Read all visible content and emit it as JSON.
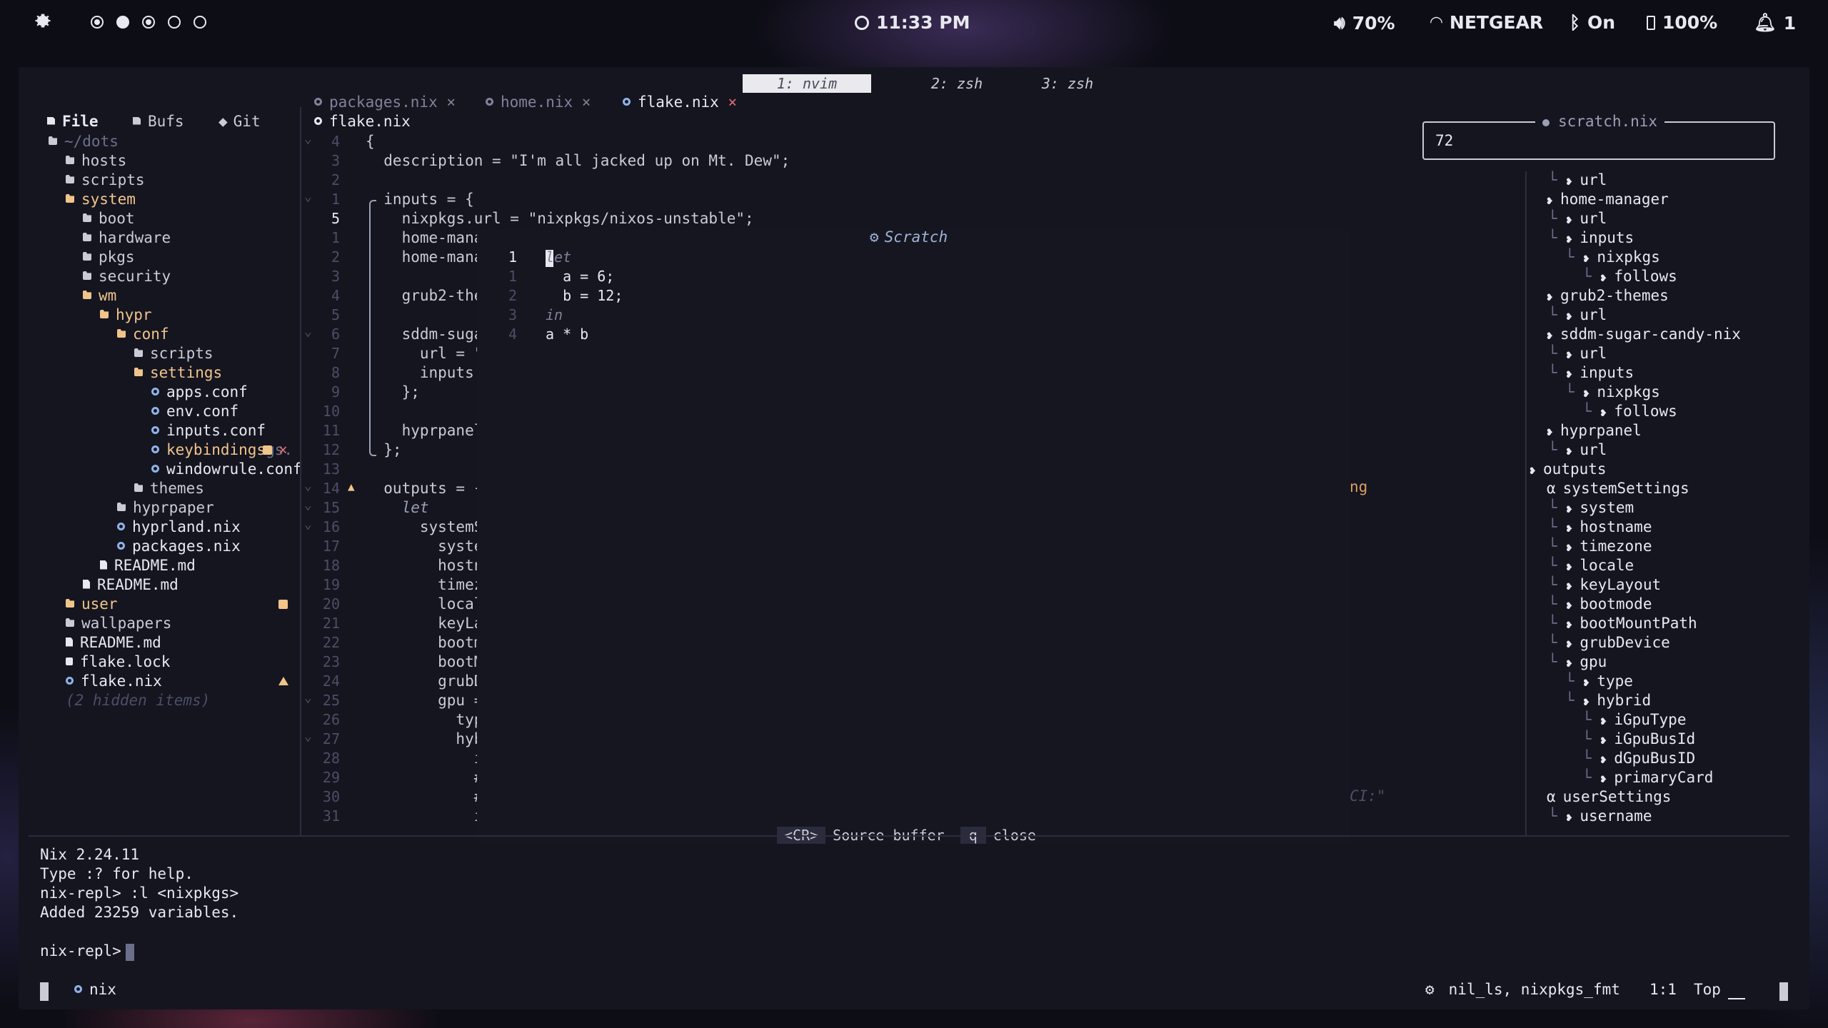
{
  "topbar": {
    "clock": "11:33 PM",
    "volume": "70%",
    "network": "NETGEAR",
    "bluetooth": "On",
    "battery": "100%",
    "notifications": "1"
  },
  "tmux_tabs": [
    "1: nvim",
    "2: zsh",
    "3: zsh"
  ],
  "explorer": {
    "tabs": [
      "File",
      "Bufs",
      "Git"
    ],
    "items": [
      {
        "label": "~/dots",
        "indent": 0,
        "icon": "folder-open-icon",
        "color": "#6b6f8a"
      },
      {
        "label": "hosts",
        "indent": 1,
        "icon": "folder-icon",
        "color": "#c9cbd6"
      },
      {
        "label": "scripts",
        "indent": 1,
        "icon": "folder-icon",
        "color": "#c9cbd6"
      },
      {
        "label": "system",
        "indent": 1,
        "icon": "folder-open-icon",
        "color": "#f0c58a"
      },
      {
        "label": "boot",
        "indent": 2,
        "icon": "folder-icon",
        "color": "#c9cbd6"
      },
      {
        "label": "hardware",
        "indent": 2,
        "icon": "folder-icon",
        "color": "#c9cbd6"
      },
      {
        "label": "pkgs",
        "indent": 2,
        "icon": "folder-icon",
        "color": "#c9cbd6"
      },
      {
        "label": "security",
        "indent": 2,
        "icon": "folder-icon",
        "color": "#c9cbd6"
      },
      {
        "label": "wm",
        "indent": 2,
        "icon": "folder-open-icon",
        "color": "#f0c58a"
      },
      {
        "label": "hypr",
        "indent": 3,
        "icon": "folder-open-icon",
        "color": "#f0c58a"
      },
      {
        "label": "conf",
        "indent": 4,
        "icon": "folder-open-icon",
        "color": "#f0c58a"
      },
      {
        "label": "scripts",
        "indent": 5,
        "icon": "folder-icon",
        "color": "#c9cbd6"
      },
      {
        "label": "settings",
        "indent": 5,
        "icon": "folder-open-icon",
        "color": "#f0c58a"
      },
      {
        "label": "apps.conf",
        "indent": 6,
        "icon": "gear-icon",
        "color": "#e8e8ef"
      },
      {
        "label": "env.conf",
        "indent": 6,
        "icon": "gear-icon",
        "color": "#e8e8ef"
      },
      {
        "label": "inputs.conf",
        "indent": 6,
        "icon": "gear-icon",
        "color": "#e8e8ef"
      },
      {
        "label": "keybindings",
        "indent": 6,
        "icon": "gear-icon",
        "color": "#f0c58a",
        "trail": "gs.",
        "badge": "modified",
        "close": "×"
      },
      {
        "label": "windowrule.conf",
        "indent": 6,
        "icon": "gear-icon",
        "color": "#e8e8ef"
      },
      {
        "label": "themes",
        "indent": 5,
        "icon": "folder-icon",
        "color": "#c9cbd6"
      },
      {
        "label": "hyprpaper",
        "indent": 4,
        "icon": "folder-icon",
        "color": "#c9cbd6"
      },
      {
        "label": "hyprland.nix",
        "indent": 4,
        "icon": "gear-icon",
        "color": "#e8e8ef"
      },
      {
        "label": "packages.nix",
        "indent": 4,
        "icon": "gear-icon",
        "color": "#e8e8ef"
      },
      {
        "label": "README.md",
        "indent": 3,
        "icon": "doc-icon",
        "color": "#e8e8ef"
      },
      {
        "label": "README.md",
        "indent": 2,
        "icon": "doc-icon",
        "color": "#e8e8ef"
      },
      {
        "label": "user",
        "indent": 1,
        "icon": "folder-icon",
        "color": "#f0c58a",
        "badge": "modified"
      },
      {
        "label": "wallpapers",
        "indent": 1,
        "icon": "folder-icon",
        "color": "#c9cbd6"
      },
      {
        "label": "README.md",
        "indent": 1,
        "icon": "doc-icon",
        "color": "#e8e8ef"
      },
      {
        "label": "flake.lock",
        "indent": 1,
        "icon": "lock-icon",
        "color": "#e8e8ef"
      },
      {
        "label": "flake.nix",
        "indent": 1,
        "icon": "gear-icon",
        "color": "#e8e8ef",
        "badge": "warning"
      },
      {
        "label": "(2 hidden items)",
        "indent": 1,
        "icon": "",
        "color": "#4b4e66",
        "italic": true
      }
    ]
  },
  "buffer_tabs": [
    {
      "label": "packages.nix",
      "close": "×",
      "active": false
    },
    {
      "label": "home.nix",
      "close": "×",
      "active": false
    },
    {
      "label": "flake.nix",
      "close": "×",
      "active": true
    }
  ],
  "breadcrumb": "flake.nix",
  "editor": {
    "lines": [
      {
        "n": "4",
        "fold": "⌄",
        "text": "{"
      },
      {
        "n": "3",
        "fold": "",
        "text": "  description = \"I'm all jacked up on Mt. Dew\";"
      },
      {
        "n": "2",
        "fold": "",
        "text": ""
      },
      {
        "n": "1",
        "fold": "⌄",
        "text": "  inputs = {"
      },
      {
        "n": "5",
        "fold": "",
        "text": "    nixpkgs.url = \"nixpkgs/nixos-unstable\";",
        "current": true
      },
      {
        "n": "1",
        "fold": "",
        "text": "    home-mana"
      },
      {
        "n": "2",
        "fold": "",
        "text": "    home-mana"
      },
      {
        "n": "3",
        "fold": "",
        "text": ""
      },
      {
        "n": "4",
        "fold": "",
        "text": "    grub2-the"
      },
      {
        "n": "5",
        "fold": "",
        "text": ""
      },
      {
        "n": "6",
        "fold": "⌄",
        "text": "    sddm-suga"
      },
      {
        "n": "7",
        "fold": "",
        "text": "      url = \""
      },
      {
        "n": "8",
        "fold": "",
        "text": "      inputs."
      },
      {
        "n": "9",
        "fold": "",
        "text": "    };"
      },
      {
        "n": "10",
        "fold": "",
        "text": ""
      },
      {
        "n": "11",
        "fold": "",
        "text": "    hyprpanel"
      },
      {
        "n": "12",
        "fold": "",
        "text": "  };"
      },
      {
        "n": "13",
        "fold": "",
        "text": ""
      },
      {
        "n": "14",
        "fold": "⌄",
        "text": "  outputs = {",
        "warn": "▲"
      },
      {
        "n": "15",
        "fold": "⌄",
        "text": "    let",
        "italic": true
      },
      {
        "n": "16",
        "fold": "⌄",
        "text": "      systemS"
      },
      {
        "n": "17",
        "fold": "",
        "text": "        syste"
      },
      {
        "n": "18",
        "fold": "",
        "text": "        hostn"
      },
      {
        "n": "19",
        "fold": "",
        "text": "        timez"
      },
      {
        "n": "20",
        "fold": "",
        "text": "        local"
      },
      {
        "n": "21",
        "fold": "",
        "text": "        keyLa"
      },
      {
        "n": "22",
        "fold": "",
        "text": "        bootm"
      },
      {
        "n": "23",
        "fold": "",
        "text": "        bootM"
      },
      {
        "n": "24",
        "fold": "",
        "text": "        grubD"
      },
      {
        "n": "25",
        "fold": "⌄",
        "text": "        gpu ="
      },
      {
        "n": "26",
        "fold": "",
        "text": "          typ"
      },
      {
        "n": "27",
        "fold": "⌄",
        "text": "          hyb"
      },
      {
        "n": "28",
        "fold": "",
        "text": "            i"
      },
      {
        "n": "29",
        "fold": "",
        "text": "            #"
      },
      {
        "n": "30",
        "fold": "",
        "text": "            #"
      },
      {
        "n": "31",
        "fold": "",
        "text": "            i"
      }
    ],
    "right_fragments": {
      "ng": "ng",
      "ci": "CI:\""
    }
  },
  "scratch": {
    "title": "Scratch",
    "lines": [
      {
        "n": "1",
        "text": "let",
        "italic": true,
        "cur": true
      },
      {
        "n": "1",
        "text": "  a = 6;"
      },
      {
        "n": "2",
        "text": "  b = 12;"
      },
      {
        "n": "3",
        "text": "in",
        "italic": true
      },
      {
        "n": "4",
        "text": "a * b"
      }
    ],
    "footer": {
      "key1": "<CR>",
      "label1": "Source buffer",
      "key2": "q",
      "label2": "close"
    }
  },
  "result_box": {
    "value": "72",
    "title": "scratch.nix"
  },
  "outline": [
    {
      "label": "url",
      "depth": 1,
      "sym": "prop"
    },
    {
      "label": "home-manager",
      "depth": 0,
      "sym": "prop"
    },
    {
      "label": "url",
      "depth": 1,
      "sym": "prop"
    },
    {
      "label": "inputs",
      "depth": 1,
      "sym": "prop"
    },
    {
      "label": "nixpkgs",
      "depth": 2,
      "sym": "prop"
    },
    {
      "label": "follows",
      "depth": 3,
      "sym": "prop"
    },
    {
      "label": "grub2-themes",
      "depth": 0,
      "sym": "prop"
    },
    {
      "label": "url",
      "depth": 1,
      "sym": "prop"
    },
    {
      "label": "sddm-sugar-candy-nix",
      "depth": 0,
      "sym": "prop"
    },
    {
      "label": "url",
      "depth": 1,
      "sym": "prop"
    },
    {
      "label": "inputs",
      "depth": 1,
      "sym": "prop"
    },
    {
      "label": "nixpkgs",
      "depth": 2,
      "sym": "prop"
    },
    {
      "label": "follows",
      "depth": 3,
      "sym": "prop"
    },
    {
      "label": "hyprpanel",
      "depth": 0,
      "sym": "prop"
    },
    {
      "label": "url",
      "depth": 1,
      "sym": "prop"
    },
    {
      "label": "outputs",
      "depth": -1,
      "sym": "prop"
    },
    {
      "label": "systemSettings",
      "depth": 0,
      "sym": "alpha"
    },
    {
      "label": "system",
      "depth": 1,
      "sym": "prop"
    },
    {
      "label": "hostname",
      "depth": 1,
      "sym": "prop"
    },
    {
      "label": "timezone",
      "depth": 1,
      "sym": "prop"
    },
    {
      "label": "locale",
      "depth": 1,
      "sym": "prop"
    },
    {
      "label": "keyLayout",
      "depth": 1,
      "sym": "prop"
    },
    {
      "label": "bootmode",
      "depth": 1,
      "sym": "prop"
    },
    {
      "label": "bootMountPath",
      "depth": 1,
      "sym": "prop"
    },
    {
      "label": "grubDevice",
      "depth": 1,
      "sym": "prop"
    },
    {
      "label": "gpu",
      "depth": 1,
      "sym": "prop"
    },
    {
      "label": "type",
      "depth": 2,
      "sym": "prop"
    },
    {
      "label": "hybrid",
      "depth": 2,
      "sym": "prop"
    },
    {
      "label": "iGpuType",
      "depth": 3,
      "sym": "prop"
    },
    {
      "label": "iGpuBusId",
      "depth": 3,
      "sym": "prop"
    },
    {
      "label": "dGpuBusID",
      "depth": 3,
      "sym": "prop"
    },
    {
      "label": "primaryCard",
      "depth": 3,
      "sym": "prop"
    },
    {
      "label": "userSettings",
      "depth": 0,
      "sym": "alpha"
    },
    {
      "label": "username",
      "depth": 1,
      "sym": "prop"
    }
  ],
  "repl": {
    "lines": [
      "Nix 2.24.11",
      "Type :? for help.",
      "nix-repl> :l <nixpkgs>",
      "Added 23259 variables.",
      "",
      "nix-repl> "
    ]
  },
  "statusline": {
    "filetype": "nix",
    "lsp": "nil_ls, nixpkgs_fmt",
    "position": "1:1",
    "scroll": "Top"
  }
}
